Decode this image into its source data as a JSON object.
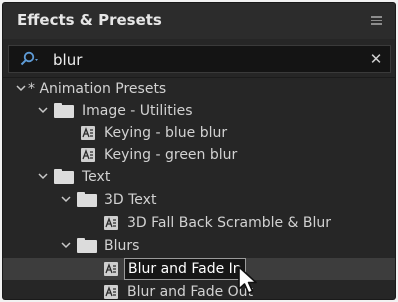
{
  "panel": {
    "title": "Effects & Presets"
  },
  "search": {
    "value": "blur"
  },
  "tree": [
    {
      "label": "* Animation Presets",
      "type": "category"
    },
    {
      "label": "Image - Utilities",
      "type": "folder"
    },
    {
      "label": "Keying - blue blur",
      "type": "preset"
    },
    {
      "label": "Keying - green blur",
      "type": "preset"
    },
    {
      "label": "Text",
      "type": "folder"
    },
    {
      "label": "3D Text",
      "type": "folder"
    },
    {
      "label": "3D Fall Back Scramble & Blur",
      "type": "preset"
    },
    {
      "label": "Blurs",
      "type": "folder"
    },
    {
      "label": "Blur and Fade In",
      "type": "preset",
      "selected": true
    },
    {
      "label": "Blur and Fade Out",
      "type": "preset"
    }
  ],
  "icons": {
    "menu": "hamburger-menu-icon",
    "search": "search-icon",
    "clear": "close-icon",
    "expand": "chevron-down-icon",
    "folder": "folder-icon",
    "preset": "animation-preset-icon",
    "cursor": "mouse-pointer-icon"
  }
}
